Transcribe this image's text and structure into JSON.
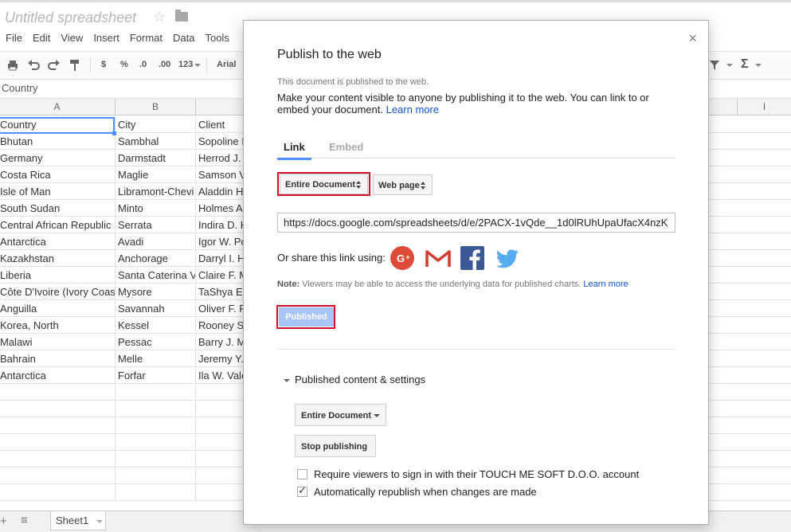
{
  "app": {
    "doc_title": "Untitled spreadsheet",
    "menu": [
      "File",
      "Edit",
      "View",
      "Insert",
      "Format",
      "Data",
      "Tools"
    ],
    "toolbar": {
      "currency": "$",
      "percent": "%",
      "dec_less": ".0",
      "dec_more": ".00",
      "more_formats": "123",
      "font": "Arial"
    },
    "formula_bar_value": "Country",
    "columns": [
      "A",
      "B",
      "I"
    ],
    "rows": [
      [
        "Country",
        "City",
        "Client"
      ],
      [
        "Bhutan",
        "Sambhal",
        "Sopoline I"
      ],
      [
        "Germany",
        "Darmstadt",
        "Herrod J."
      ],
      [
        "Costa Rica",
        "Maglie",
        "Samson V"
      ],
      [
        "Isle of Man",
        "Libramont-Chevi",
        "Aladdin H"
      ],
      [
        "South Sudan",
        "Minto",
        "Holmes A"
      ],
      [
        "Central African Republic",
        "Serrata",
        "Indira D. H"
      ],
      [
        "Antarctica",
        "Avadi",
        "Igor W. Po"
      ],
      [
        "Kazakhstan",
        "Anchorage",
        "Darryl I. H"
      ],
      [
        "Liberia",
        "Santa Caterina V",
        "Claire F. M"
      ],
      [
        "Côte D'Ivoire (Ivory Coast",
        "Mysore",
        "TaShya E"
      ],
      [
        "Anguilla",
        "Savannah",
        "Oliver F. F"
      ],
      [
        "Korea, North",
        "Kessel",
        "Rooney S"
      ],
      [
        "Malawi",
        "Pessac",
        "Barry J. M"
      ],
      [
        "Bahrain",
        "Melle",
        "Jeremy Y."
      ],
      [
        "Antarctica",
        "Forfar",
        "Ila W. Vale"
      ],
      [
        "",
        "",
        ""
      ],
      [
        "",
        "",
        ""
      ],
      [
        "",
        "",
        ""
      ],
      [
        "",
        "",
        ""
      ],
      [
        "",
        "",
        ""
      ],
      [
        "",
        "",
        ""
      ],
      [
        "",
        "",
        ""
      ]
    ],
    "sheet_tab": "Sheet1"
  },
  "dialog": {
    "title": "Publish to the web",
    "close_glyph": "×",
    "status": "This document is published to the web.",
    "description": "Make your content visible to anyone by publishing it to the web. You can link to or embed your document.",
    "learn_more": "Learn more",
    "tabs": {
      "link": "Link",
      "embed": "Embed"
    },
    "scope_select": "Entire Document",
    "format_select": "Web page",
    "url": "https://docs.google.com/spreadsheets/d/e/2PACX-1vQde__1d0lRUhUpaUfacX4nzK",
    "share_label": "Or share this link using:",
    "note_label": "Note:",
    "note_text": "Viewers may be able to access the underlying data for published charts.",
    "note_link": "Learn more",
    "published_button": "Published",
    "settings_header": "Published content & settings",
    "settings_scope": "Entire Document",
    "stop_button": "Stop publishing",
    "checkbox_signin": "Require viewers to sign in with their TOUCH ME SOFT D.O.O. account",
    "checkbox_signin_checked": false,
    "checkbox_republish": "Automatically republish when changes are made",
    "checkbox_republish_checked": true,
    "colors": {
      "accent": "#4d90fe",
      "highlight": "#d2102a",
      "link": "#1155cc",
      "published_bg": "#a7c5f7"
    }
  }
}
